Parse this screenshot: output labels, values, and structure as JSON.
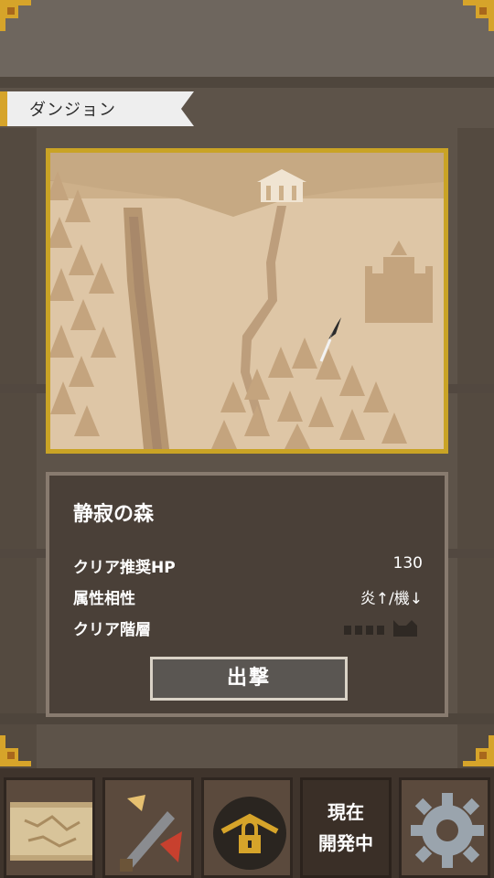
{
  "section_tab": {
    "label": "ダンジョン"
  },
  "dungeon": {
    "name": "静寂の森",
    "stats": [
      {
        "label": "クリア推奨HP",
        "value": "130"
      },
      {
        "label": "属性相性",
        "value": "炎↑/機↓"
      },
      {
        "label": "クリア階層",
        "value": ""
      }
    ],
    "cleared_floors": 0,
    "total_floors": 5,
    "sortie_label": "出撃"
  },
  "bottom_nav": {
    "items": [
      {
        "name": "map",
        "icon": "map-scroll-icon"
      },
      {
        "name": "equipment",
        "icon": "sword-upgrade-icon"
      },
      {
        "name": "locked",
        "icon": "locked-bag-icon"
      },
      {
        "name": "in-development",
        "lines": [
          "現在",
          "開発中"
        ]
      },
      {
        "name": "settings",
        "icon": "gear-icon"
      }
    ]
  },
  "colors": {
    "background": "#5d5349",
    "map_frame": "#c9a325",
    "panel": "#4a4038",
    "corner_ornament": "#d6a42a"
  }
}
